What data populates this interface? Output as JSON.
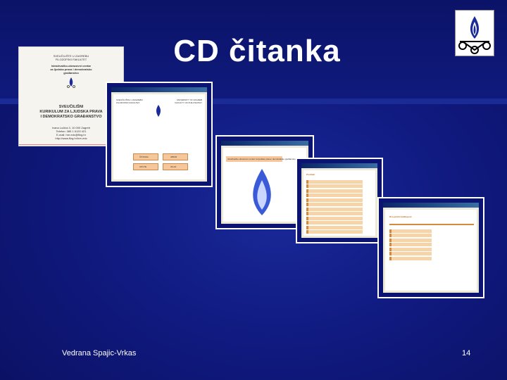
{
  "slide": {
    "title": "CD čitanka",
    "author": "Vedrana Spajic-Vrkas",
    "page_number": "14"
  },
  "document_cover": {
    "header_lines": [
      "SVEUČILIŠTE U ZAGREBU",
      "FILOZOFSKI FAKULTET"
    ],
    "center_lines": [
      "Istraživačko-obrazovni centar",
      "za ljudska prava i demokratsko",
      "građanstvo"
    ],
    "title_lines": [
      "SVEUČILIŠNI",
      "KURIKULUM ZA LJUDSKA PRAVA",
      "I DEMOKRATSKO GRAĐANSTVO"
    ],
    "contact_lines": [
      "Ivana Lučića 3, 10 000 Zagreb",
      "Telefon: 385 1 6120 421",
      "E-mail: hre.edc@ffzg.hr",
      "http://www.ffzg.hr/hre-edc"
    ]
  },
  "screenshot1": {
    "left_org": [
      "SVEUČILIŠTE U ZAGREBU",
      "FILOZOFSKI FAKULTET"
    ],
    "right_org": [
      "UNIVERSITY OF ZAGREB",
      "FACULTY OF PHILOSOPHY"
    ],
    "buttons": [
      "ČITANKA",
      "IZBOR",
      "UPUTE",
      "IZLAZ"
    ]
  },
  "screenshot2": {
    "banner": "Istraživačko-obrazovni centar za ljudska prava i demokratsko građanstvo"
  },
  "screenshot3": {
    "heading": "Pročitati"
  },
  "screenshot4": {
    "heading": "Dvo-jezični kalibopeni"
  },
  "colors": {
    "background": "#101a80",
    "frame_border": "#ffffff",
    "button_fill": "#f5c79a",
    "text": "#ffffff"
  }
}
